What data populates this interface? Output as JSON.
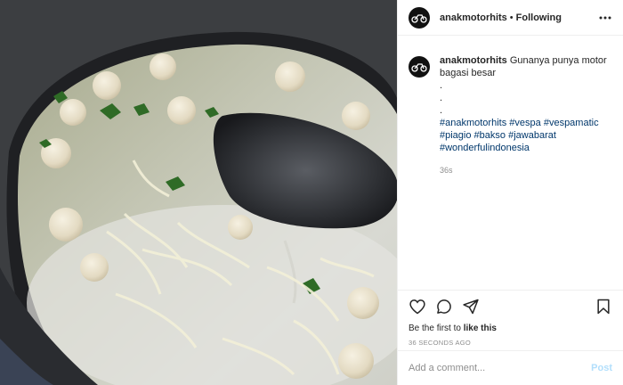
{
  "header": {
    "username": "anakmotorhits",
    "separator": "•",
    "follow_status": "Following"
  },
  "caption": {
    "username": "anakmotorhits",
    "text": "Gunanya punya motor bagasi besar",
    "dots": [
      ".",
      ".",
      "."
    ],
    "hashtags_line1": [
      "#anakmotorhits",
      "#vespa",
      "#vespamatic"
    ],
    "hashtags_line2": [
      "#piagio",
      "#bakso",
      "#jawabarat"
    ],
    "hashtags_line3": [
      "#wonderfulindonesia"
    ],
    "time": "36s"
  },
  "actions": {
    "icons": [
      "heart-icon",
      "comment-icon",
      "share-icon",
      "bookmark-icon"
    ]
  },
  "likes": {
    "prefix": "Be the first to",
    "link": "like this"
  },
  "post_date": "36 SECONDS AGO",
  "comment": {
    "placeholder": "Add a comment...",
    "post_label": "Post"
  },
  "colors": {
    "hashtag": "#00376b",
    "post_disabled": "#b2dffc",
    "muted": "#8e8e8e"
  }
}
